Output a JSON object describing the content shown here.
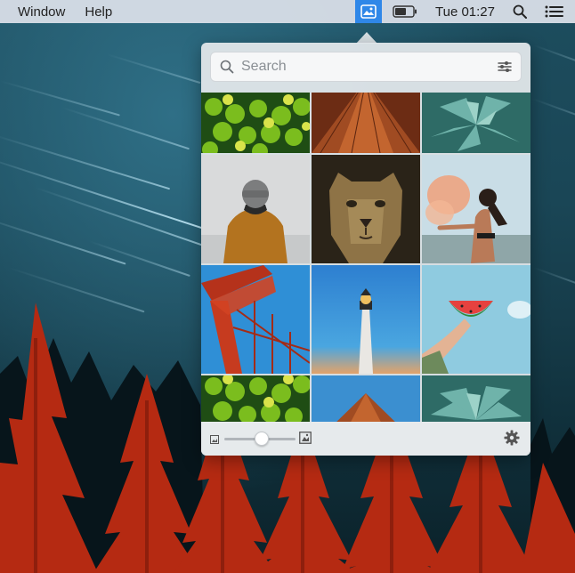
{
  "menubar": {
    "items": [
      "Window",
      "Help"
    ],
    "clock": "Tue 01:27",
    "status_icons": [
      "photos-app-icon",
      "battery-icon",
      "spotlight-search-icon",
      "notification-list-icon"
    ]
  },
  "popover": {
    "search": {
      "placeholder": "Search",
      "value": ""
    },
    "filter_icon": "sliders-icon",
    "photos": [
      "limes",
      "building-looking-up",
      "succulent",
      "person-in-beanie",
      "lioness",
      "woman-with-smoke",
      "golden-gate-bridge",
      "lighthouse",
      "watermelon-slice",
      "limes",
      "building-looking-up",
      "succulent"
    ],
    "thumbnail_size": {
      "value": 0.5
    },
    "settings_icon": "gear-icon"
  },
  "colors": {
    "accent": "#2f87e8",
    "menubar": "#d6dde6",
    "popover": "#e2e7ea"
  }
}
